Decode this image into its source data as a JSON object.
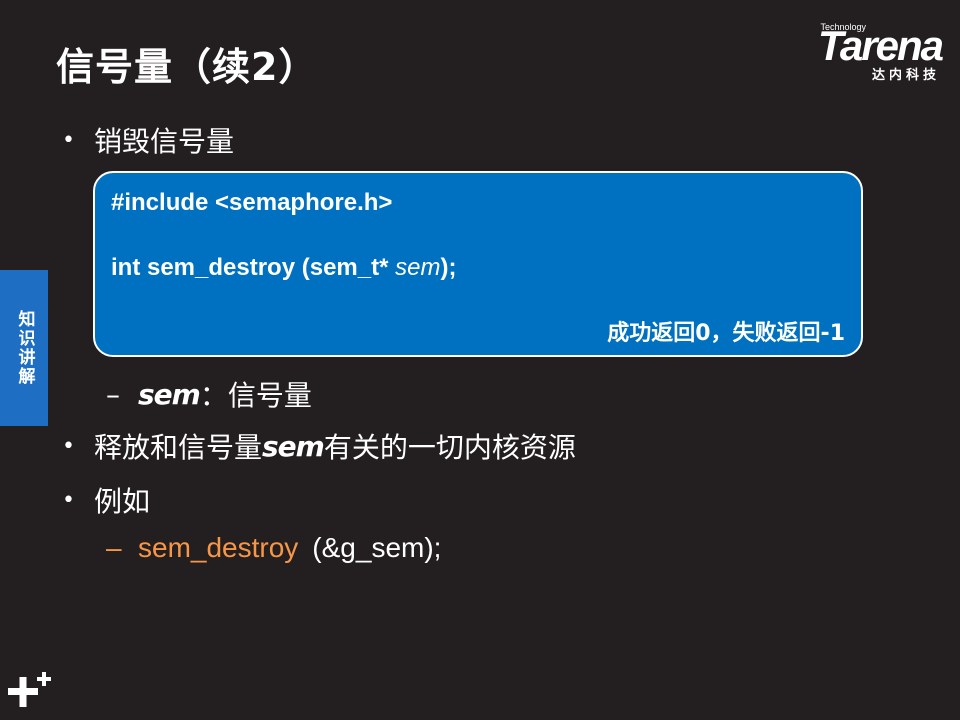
{
  "slide": {
    "title": "信号量（续2）"
  },
  "logo": {
    "tagline": "Technology",
    "wordmark": "Tarena",
    "cn_name": "达内科技"
  },
  "side_tab": {
    "label": "知识讲解"
  },
  "bullets": {
    "b1": "销毁信号量",
    "b2_prefix": "释放和信号量",
    "b2_term": "sem",
    "b2_suffix": "有关的一切内核资源",
    "b3": "例如"
  },
  "code": {
    "include": "#include <semaphore.h>",
    "sig_prefix": "int sem_destroy (sem_t* ",
    "sig_param": "sem",
    "sig_suffix": ");",
    "return_note": "成功返回0，失败返回-1"
  },
  "param": {
    "dash": "–",
    "name": "sem",
    "desc": "：信号量"
  },
  "example": {
    "dash": "–",
    "func": "sem_destroy",
    "args": "(&g_sem);"
  },
  "bullet_glyph": "•",
  "colors": {
    "background": "#231f20",
    "code_box": "#0070c0",
    "side_tab": "#1e6fc3",
    "example_accent": "#f79646"
  }
}
